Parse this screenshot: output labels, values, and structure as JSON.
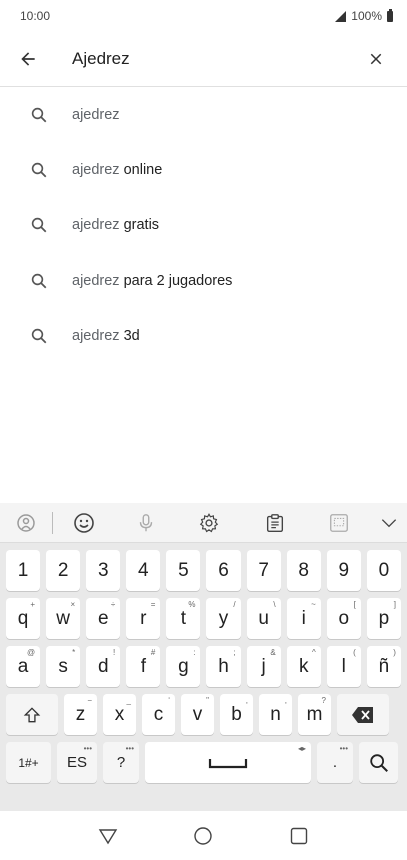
{
  "status": {
    "time": "10:00",
    "battery": "100%"
  },
  "search": {
    "value": "Ajedrez"
  },
  "suggestions": [
    {
      "query": "ajedrez",
      "completion": ""
    },
    {
      "query": "ajedrez",
      "completion": " online"
    },
    {
      "query": "ajedrez",
      "completion": " gratis"
    },
    {
      "query": "ajedrez",
      "completion": " para 2 jugadores"
    },
    {
      "query": "ajedrez",
      "completion": " 3d"
    }
  ],
  "keyboard": {
    "number_row": [
      "1",
      "2",
      "3",
      "4",
      "5",
      "6",
      "7",
      "8",
      "9",
      "0"
    ],
    "row1": [
      {
        "k": "q",
        "h": "+"
      },
      {
        "k": "w",
        "h": "×"
      },
      {
        "k": "e",
        "h": "÷"
      },
      {
        "k": "r",
        "h": "="
      },
      {
        "k": "t",
        "h": "%"
      },
      {
        "k": "y",
        "h": "/"
      },
      {
        "k": "u",
        "h": "\\"
      },
      {
        "k": "i",
        "h": "~"
      },
      {
        "k": "o",
        "h": "["
      },
      {
        "k": "p",
        "h": "]"
      }
    ],
    "row2": [
      {
        "k": "a",
        "h": "@"
      },
      {
        "k": "s",
        "h": "*"
      },
      {
        "k": "d",
        "h": "!"
      },
      {
        "k": "f",
        "h": "#"
      },
      {
        "k": "g",
        "h": ":"
      },
      {
        "k": "h",
        "h": ";"
      },
      {
        "k": "j",
        "h": "&"
      },
      {
        "k": "k",
        "h": "^"
      },
      {
        "k": "l",
        "h": "("
      },
      {
        "k": "ñ",
        "h": ")"
      }
    ],
    "row3": [
      {
        "k": "z",
        "h": "−"
      },
      {
        "k": "x",
        "h": "_"
      },
      {
        "k": "c",
        "h": "‘"
      },
      {
        "k": "v",
        "h": "\""
      },
      {
        "k": "b",
        "h": ","
      },
      {
        "k": "n",
        "h": ","
      },
      {
        "k": "m",
        "h": "?"
      }
    ],
    "symbols_label": "1#+",
    "lang_label": "ES",
    "question_label": "?",
    "period_label": ".",
    "more_hint": "•••"
  }
}
